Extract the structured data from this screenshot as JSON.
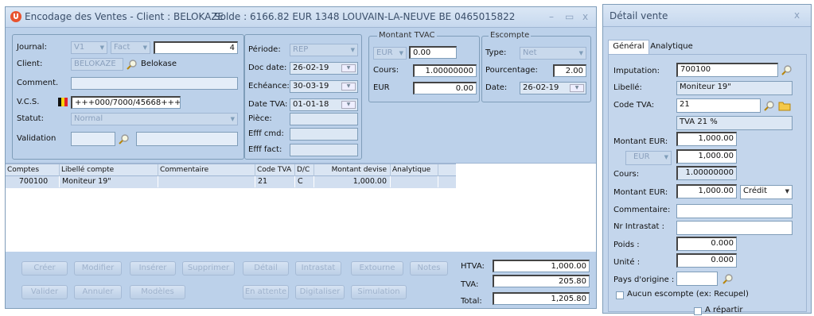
{
  "main_window": {
    "title": "Encodage des Ventes - Client : BELOKAZE",
    "solde_label": "Solde : 6166.82 EUR 1348 LOUVAIN-LA-NEUVE BE 0465015822",
    "controls": {
      "minimize": "–",
      "restore": "▭",
      "close": "x"
    }
  },
  "header": {
    "journal": {
      "label": "Journal:",
      "code": "V1",
      "type": "Fact",
      "number": "4"
    },
    "client": {
      "label": "Client:",
      "code": "BELOKAZE",
      "name": "Belokase"
    },
    "comment": {
      "label": "Comment.",
      "value": ""
    },
    "vcs": {
      "label": "V.C.S.",
      "value": "+++000/7000/45668+++"
    },
    "statut": {
      "label": "Statut:",
      "value": "Normal"
    },
    "validation": {
      "label": "Validation",
      "value1": "",
      "value2": ""
    },
    "periode": {
      "label": "Période:",
      "value": "REP"
    },
    "doc_date": {
      "label": "Doc date:",
      "value": "26-02-19"
    },
    "echeance": {
      "label": "Echéance:",
      "value": "30-03-19"
    },
    "date_tva": {
      "label": "Date TVA:",
      "value": "01-01-18"
    },
    "piece": {
      "label": "Pièce:",
      "value": ""
    },
    "effi_cmd": {
      "label": "Efff cmd:",
      "value": ""
    },
    "effi_fact": {
      "label": "Efff fact:",
      "value": ""
    }
  },
  "montant_tvac": {
    "legend": "Montant TVAC",
    "currency": "EUR",
    "amount": "0.00",
    "cours_label": "Cours:",
    "cours_value": "1.00000000",
    "eur_label": "EUR",
    "eur_value": "0.00"
  },
  "escompte": {
    "legend": "Escompte",
    "type_label": "Type:",
    "type_value": "Net",
    "pourcentage_label": "Pourcentage:",
    "pourcentage_value": "2.00",
    "date_label": "Date:",
    "date_value": "26-02-19"
  },
  "grid": {
    "columns": [
      "Comptes",
      "Libellé compte",
      "Commentaire",
      "Code TVA",
      "D/C",
      "Montant devise",
      "Analytique"
    ],
    "rows": [
      {
        "compte": "700100",
        "libelle": "Moniteur 19\"",
        "commentaire": "",
        "code_tva": "21",
        "dc": "C",
        "montant": "1,000.00",
        "analytique": ""
      }
    ]
  },
  "buttons_row1": [
    "Créer",
    "Modifier",
    "Insérer",
    "Supprimer",
    "Détail",
    "Intrastat",
    "Extourne",
    "Notes"
  ],
  "buttons_row2": [
    "Valider",
    "Annuler",
    "Modèles",
    "En attente",
    "Digitaliser",
    "Simulation"
  ],
  "totals": {
    "htva_label": "HTVA:",
    "htva": "1,000.00",
    "tva_label": "TVA:",
    "tva": "205.80",
    "total_label": "Total:",
    "total": "1,205.80"
  },
  "detail_window": {
    "title": "Détail vente",
    "close": "x",
    "tabs": [
      "Général",
      "Analytique"
    ],
    "imputation_label": "Imputation:",
    "imputation": "700100",
    "libelle_label": "Libellé:",
    "libelle": "Moniteur 19\"",
    "code_tva_label": "Code TVA:",
    "code_tva": "21",
    "code_tva_desc": "TVA 21 %",
    "montant_eur_label": "Montant EUR:",
    "montant_eur": "1,000.00",
    "currency": "EUR",
    "montant_devise": "1,000.00",
    "cours_label": "Cours:",
    "cours": "1.00000000",
    "montant_eur2_label": "Montant EUR:",
    "montant_eur2": "1,000.00",
    "sens": "Crédit",
    "commentaire_label": "Commentaire:",
    "commentaire": "",
    "intrastat_label": "Nr Intrastat :",
    "intrastat": "",
    "poids_label": "Poids :",
    "poids": "0.000",
    "unite_label": "Unité :",
    "unite": "0.000",
    "pays_label": "Pays d'origine :",
    "pays": "",
    "escompte_check_label": "Aucun escompte (ex: Recupel)",
    "repartir_label": "A répartir"
  },
  "colors": {
    "window_bg": "#bcd1ea",
    "title_bg": "#c6d8ee",
    "accent": "#e8532f",
    "selected_row": "#d2dff0"
  }
}
